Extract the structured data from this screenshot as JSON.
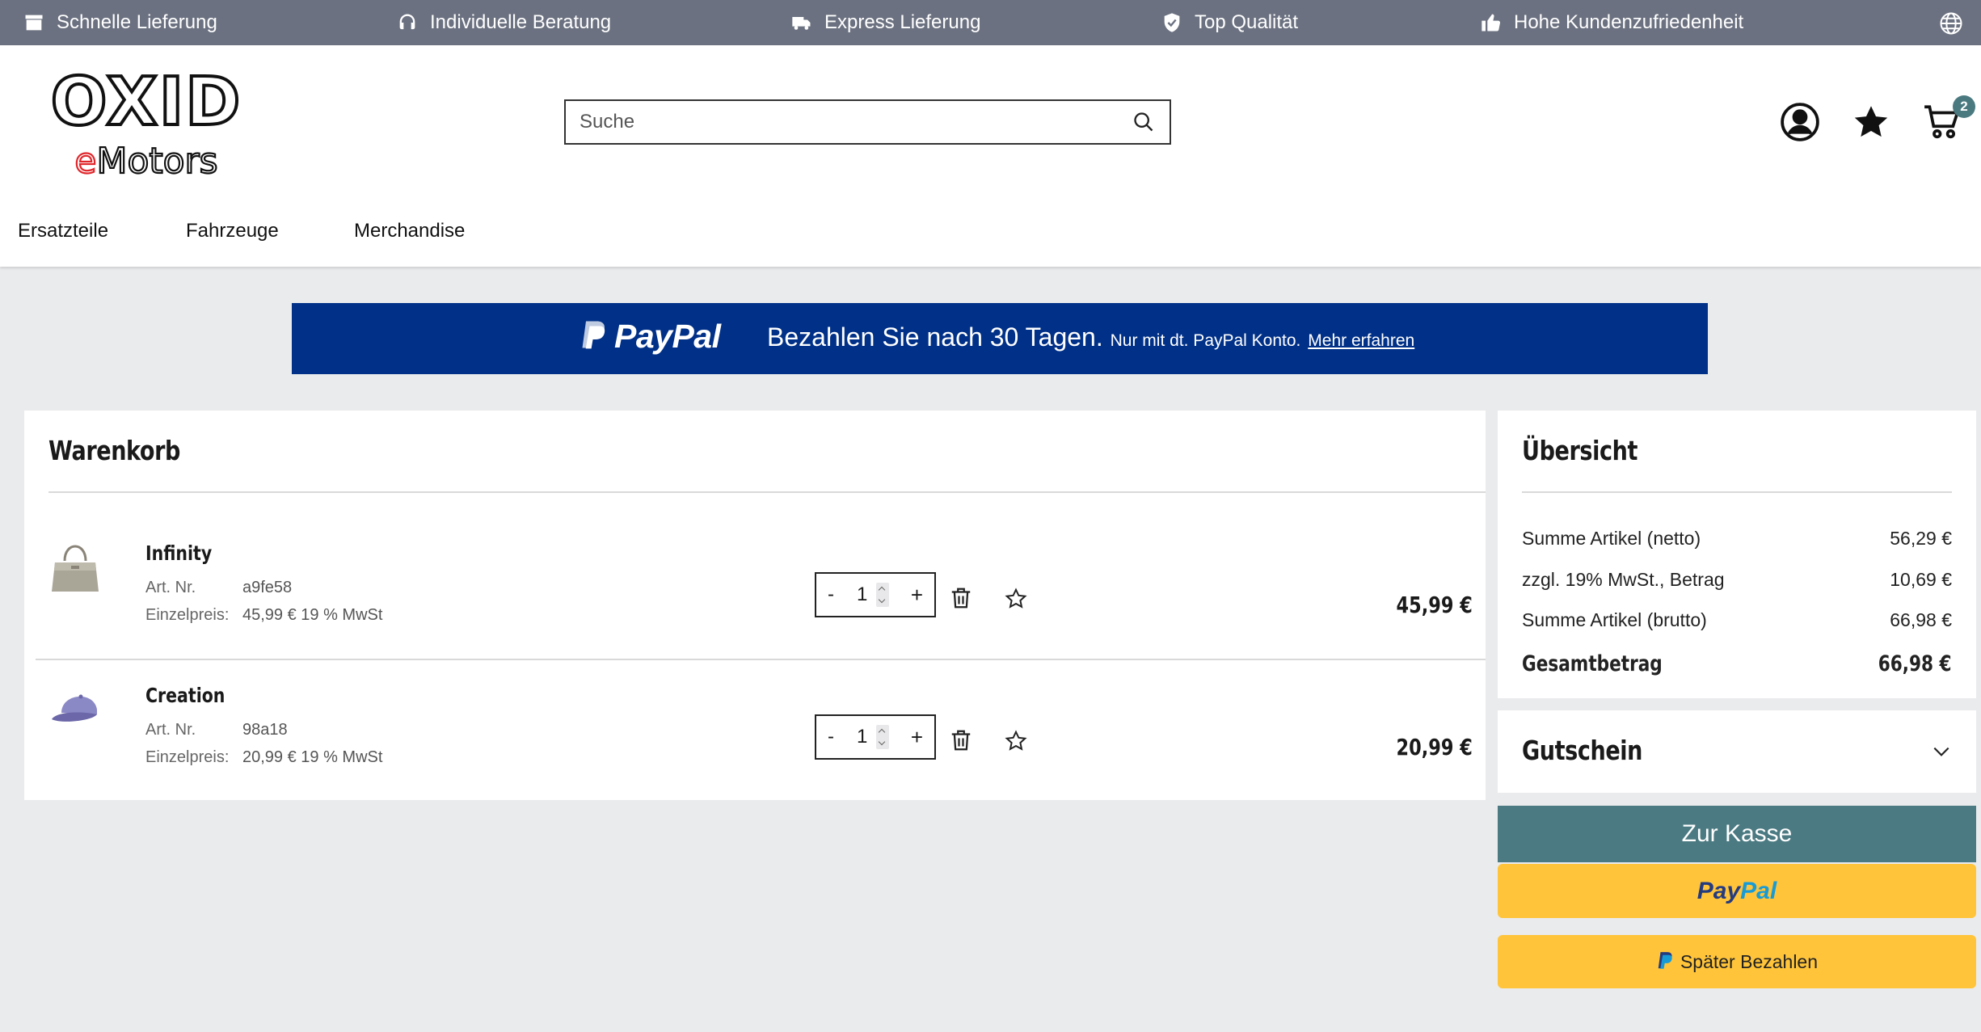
{
  "topbar": {
    "benefits": [
      {
        "label": "Schnelle Lieferung",
        "icon": "box-icon"
      },
      {
        "label": "Individuelle Beratung",
        "icon": "headset-icon"
      },
      {
        "label": "Express Lieferung",
        "icon": "truck-icon"
      },
      {
        "label": "Top Qualität",
        "icon": "shield-check-icon"
      },
      {
        "label": "Hohe Kundenzufriedenheit",
        "icon": "thumbs-up-icon"
      }
    ],
    "language_icon": "globe-icon"
  },
  "header": {
    "logo": {
      "line1": "OXID",
      "line2_accent": "e",
      "line2_rest": "Motors"
    },
    "search": {
      "placeholder": "Suche",
      "value": ""
    },
    "cart_count": "2"
  },
  "nav": {
    "items": [
      "Ersatzteile",
      "Fahrzeuge",
      "Merchandise"
    ]
  },
  "paypal_banner": {
    "brand": "PayPal",
    "message": "Bezahlen Sie nach 30 Tagen.",
    "note": "Nur mit dt. PayPal Konto.",
    "link": "Mehr erfahren"
  },
  "cart": {
    "title": "Warenkorb",
    "art_label": "Art. Nr.",
    "unit_label": "Einzelpreis:",
    "items": [
      {
        "name": "Infinity",
        "art_nr": "a9fe58",
        "unit_price": "45,99 € 19 % MwSt",
        "qty": "1",
        "total": "45,99 €"
      },
      {
        "name": "Creation",
        "art_nr": "98a18",
        "unit_price": "20,99 € 19 % MwSt",
        "qty": "1",
        "total": "20,99 €"
      }
    ]
  },
  "summary": {
    "title": "Übersicht",
    "rows": [
      {
        "label": "Summe Artikel (netto)",
        "value": "56,29 €"
      },
      {
        "label": "zzgl. 19% MwSt., Betrag",
        "value": "10,69 €"
      },
      {
        "label": "Summe Artikel (brutto)",
        "value": "66,98 €"
      }
    ],
    "total_label": "Gesamtbetrag",
    "total_value": "66,98 €"
  },
  "voucher": {
    "title": "Gutschein"
  },
  "actions": {
    "checkout": "Zur Kasse",
    "paypal_a": "Pay",
    "paypal_b": "Pal",
    "pay_later": "Später Bezahlen"
  },
  "colors": {
    "topbar": "#6b7180",
    "paypal_banner": "#003087",
    "checkout_button": "#4b7a82",
    "paypal_yellow": "#ffc43a",
    "logo_accent": "#e0262b"
  }
}
